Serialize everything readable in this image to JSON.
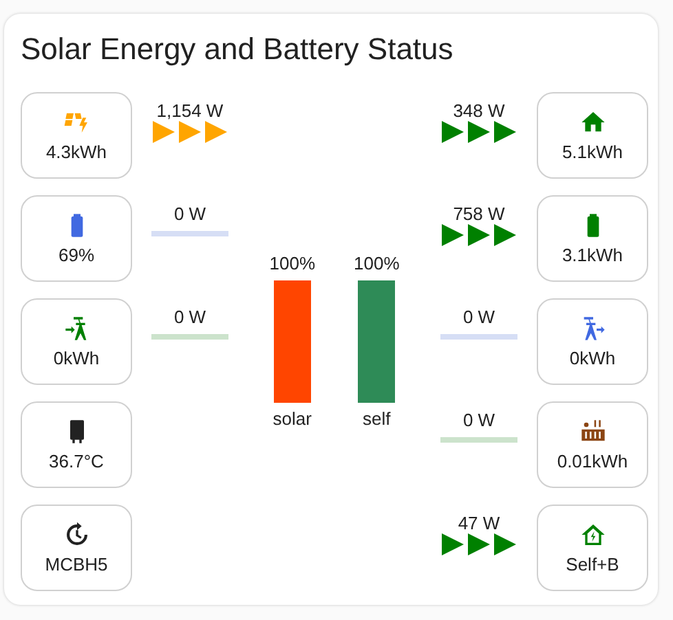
{
  "title": "Solar Energy and Battery Status",
  "left": [
    {
      "value": "4.3kWh",
      "flow": {
        "reading": "1,154 W",
        "active": true,
        "color": "#ffa500"
      }
    },
    {
      "value": "69%",
      "flow": {
        "reading": "0 W",
        "active": false,
        "color": "#d6def5"
      }
    },
    {
      "value": "0kWh",
      "flow": {
        "reading": "0 W",
        "active": false,
        "color": "#cce3cc"
      }
    },
    {
      "value": "36.7°C"
    },
    {
      "value": "MCBH5"
    }
  ],
  "right": [
    {
      "value": "5.1kWh",
      "flow": {
        "reading": "348 W",
        "active": true,
        "color": "#008000"
      }
    },
    {
      "value": "3.1kWh",
      "flow": {
        "reading": "758 W",
        "active": true,
        "color": "#008000"
      }
    },
    {
      "value": "0kWh",
      "flow": {
        "reading": "0 W",
        "active": false,
        "color": "#d6def5"
      }
    },
    {
      "value": "0.01kWh",
      "flow": {
        "reading": "0 W",
        "active": false,
        "color": "#cce3cc"
      }
    },
    {
      "value": "Self+B",
      "flow": {
        "reading": "47 W",
        "active": true,
        "color": "#008000"
      }
    }
  ],
  "bars": [
    {
      "reading": "100%",
      "color": "#ff4500",
      "label": "solar"
    },
    {
      "reading": "100%",
      "color": "#2e8b57",
      "label": "self"
    }
  ]
}
